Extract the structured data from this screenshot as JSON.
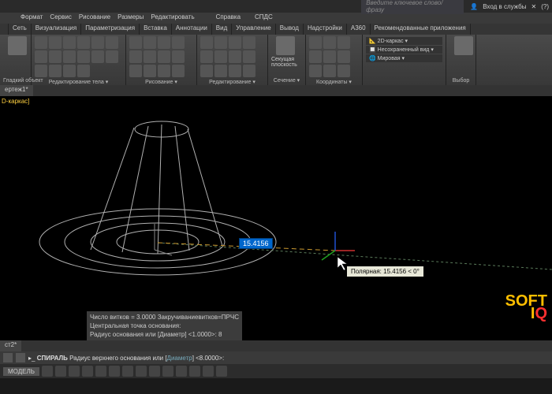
{
  "titlebar": {
    "search_placeholder": "Введите ключевое слово/фразу",
    "login": "Вход в службы"
  },
  "menu": [
    "",
    "",
    "Формат",
    "Сервис",
    "Рисование",
    "Размеры",
    "Редактировать",
    "",
    "",
    "Справка",
    "",
    "СПДС"
  ],
  "tabs": [
    "",
    "Сеть",
    "Визуализация",
    "Параметризация",
    "Вставка",
    "Аннотации",
    "Вид",
    "Управление",
    "Вывод",
    "Надстройки",
    "A360",
    "Рекомендованные приложения"
  ],
  "panels": {
    "smooth": "Гладкий объект",
    "edit_body": "Редактирование тела ▾",
    "draw": "Рисование ▾",
    "modify": "Редактирование ▾",
    "section_btn": "Секущая плоскость",
    "section": "Сечение ▾",
    "coords": "Координаты ▾",
    "view": "",
    "select": "Выбор"
  },
  "visual_styles": {
    "wire": "2D-каркас",
    "unsaved": "Несохраненный вид",
    "world": "Мировая"
  },
  "doc_tab": "ертеж1*",
  "viewport_label": "D-каркас]",
  "dim_value": "15.4156",
  "tooltip": "Полярная: 15.4156 < 0°",
  "history": [
    "Число витков = 3.0000 Закручиваниевитков=ПРЧС",
    "Центральная точка основания:",
    "Радиус основания или [Диаметр] <1.0000>: 8"
  ],
  "cmd": {
    "name": "СПИРАЛЬ",
    "text": "Радиус верхнего основания или [",
    "link": "Диаметр",
    "tail": "] <8.0000>:"
  },
  "status_mode": "МОДЕЛЬ",
  "tab2": "ст2*",
  "watermark": {
    "a": "SOFT",
    "b": "IQ"
  }
}
